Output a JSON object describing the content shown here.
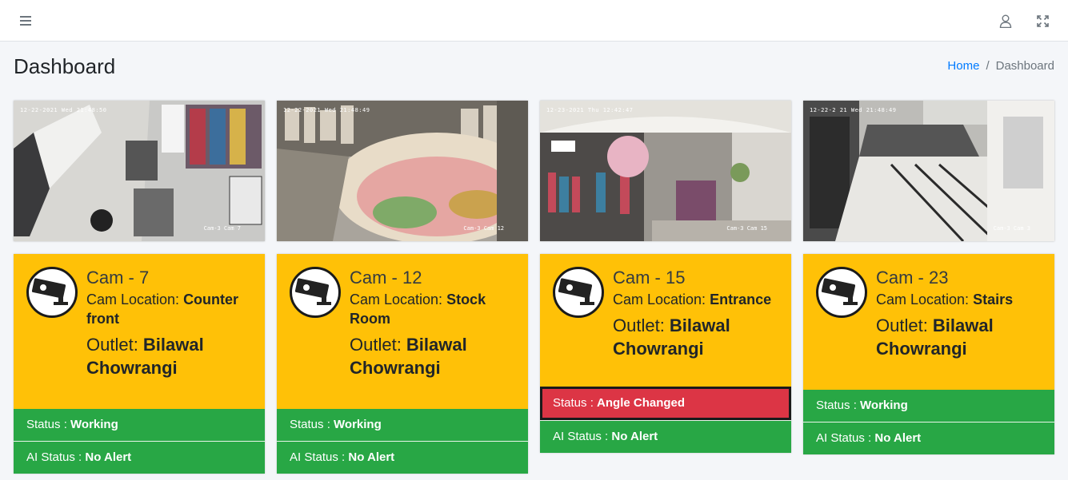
{
  "navbar": {
    "menu_icon": "hamburger-menu-icon",
    "user_icon": "user-icon",
    "fullscreen_icon": "fullscreen-icon"
  },
  "page": {
    "title": "Dashboard"
  },
  "breadcrumb": {
    "home": "Home",
    "separator": "/",
    "current": "Dashboard"
  },
  "labels": {
    "location": "Cam Location: ",
    "outlet": "Outlet: ",
    "status": "Status : ",
    "ai_status": "AI Status : "
  },
  "colors": {
    "card": "#ffc107",
    "status_ok": "#28a745",
    "status_alert": "#dc3545",
    "link": "#007bff"
  },
  "cameras": [
    {
      "name": "Cam - 7",
      "location": "Counter front",
      "outlet": "Bilawal Chowrangi",
      "status": "Working",
      "ai_status": "No Alert",
      "timestamp": "12-22-2021 Wed 21:48:50",
      "feed_label": "Cam-3 Cam 7"
    },
    {
      "name": "Cam - 12",
      "location": "Stock Room",
      "outlet": "Bilawal Chowrangi",
      "status": "Working",
      "ai_status": "No Alert",
      "timestamp": "12-22-2021 Wed 21:48:49",
      "feed_label": "Cam-3 Cam 12"
    },
    {
      "name": "Cam - 15",
      "location": "Entrance",
      "outlet": "Bilawal Chowrangi",
      "status": "Angle Changed",
      "ai_status": "No Alert",
      "timestamp": "12-23-2021 Thu 12:42:47",
      "feed_label": "Cam-3 Cam 15"
    },
    {
      "name": "Cam - 23",
      "location": "Stairs",
      "outlet": "Bilawal Chowrangi",
      "status": "Working",
      "ai_status": "No Alert",
      "timestamp": "12-22-2 21 Wed 21:48:49",
      "feed_label": "Cam-3 Cam 3"
    }
  ]
}
